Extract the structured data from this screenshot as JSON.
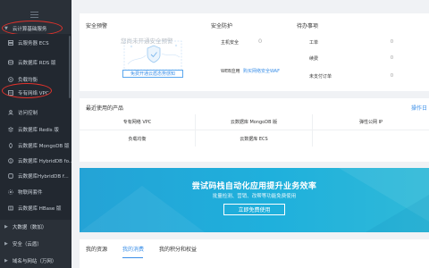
{
  "sidebar": {
    "group_top": "云计算基础服务",
    "items": [
      {
        "label": "云服务器 ECS",
        "icon": "server-icon"
      },
      {
        "label": "云数据库 RDS 版",
        "icon": "database-icon"
      },
      {
        "label": "负载均衡",
        "icon": "load-balancer-icon"
      },
      {
        "label": "专有网络 VPC",
        "icon": "vpc-icon"
      },
      {
        "label": "访问控制",
        "icon": "access-control-icon"
      },
      {
        "label": "云数据库 Redis 版",
        "icon": "redis-icon"
      },
      {
        "label": "云数据库 MongoDB 版",
        "icon": "mongodb-icon"
      },
      {
        "label": "云数据库 HybridDB fo...",
        "icon": "hybriddb-icon"
      },
      {
        "label": "云数据库HybridDB f...",
        "icon": "hybriddb2-icon"
      },
      {
        "label": "物联网套件",
        "icon": "iot-icon"
      },
      {
        "label": "云数据库 HBase 版",
        "icon": "hbase-icon"
      }
    ],
    "groups": [
      "大数据（数加）",
      "安全（云盾）",
      "域名与网站（万网）"
    ]
  },
  "security_alert": {
    "title": "安全预警",
    "notice": "您尚未开通安全预警",
    "button": "免费开通云盾态势感知"
  },
  "security_protect": {
    "title": "安全防护",
    "rows": [
      {
        "label": "主机安全",
        "value": "0",
        "unit": "件"
      },
      {
        "label": "WEB应用",
        "link": "购买网络安全WAF"
      }
    ]
  },
  "todo": {
    "title": "待办事项",
    "rows": [
      {
        "label": "工单",
        "value": "0"
      },
      {
        "label": "续费",
        "value": "0"
      },
      {
        "label": "未支付订单",
        "value": "0"
      }
    ]
  },
  "products": {
    "title": "最近使用的产品",
    "action": "操作日",
    "items": [
      "专有网络 VPC",
      "云数据库 MongoDB 版",
      "弹性公网 IP",
      "负载均衡",
      "云数据库 ECS"
    ]
  },
  "banner": {
    "title": "尝试码栈自动化应用提升业务效率",
    "subtitle": "批量检测、营销、改帮等功能免费使用",
    "button": "立即免费使用",
    "bg_color": "#23a6d9"
  },
  "tabs": [
    "我的资源",
    "我的消费",
    "我的积分和权益"
  ],
  "accent_color": "#3b8fe8",
  "mark_color": "#e0322b"
}
